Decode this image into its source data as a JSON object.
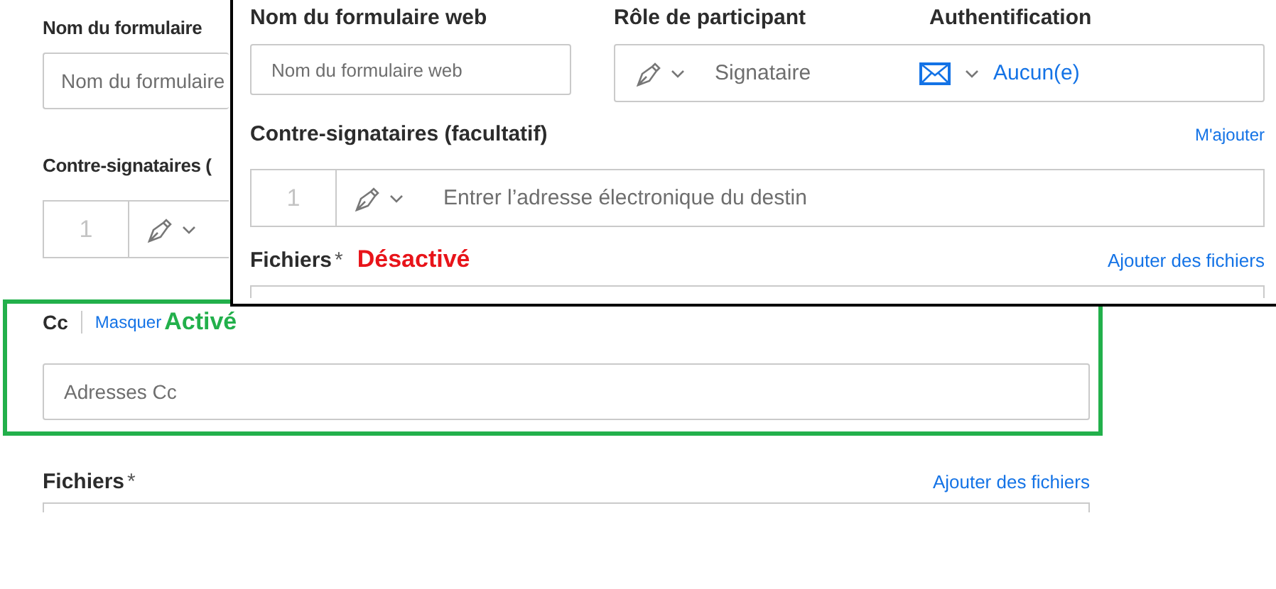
{
  "background_form": {
    "form_name": {
      "label": "Nom du formulaire",
      "placeholder": "Nom du formulaire"
    },
    "cosigners": {
      "label": "Contre-signataires (",
      "rows": [
        {
          "number": "1"
        }
      ]
    },
    "cc": {
      "label": "Cc",
      "hide_link": "Masquer",
      "annotation": {
        "text": "Activé",
        "kind": "enabled"
      },
      "placeholder": "Adresses Cc"
    },
    "files": {
      "label": "Fichiers",
      "required_mark": "*",
      "add_link": "Ajouter des fichiers"
    }
  },
  "overlay_form": {
    "form_name": {
      "label": "Nom du formulaire web",
      "placeholder": "Nom du formulaire web"
    },
    "participant_role": {
      "label": "Rôle de participant",
      "value": "Signataire"
    },
    "authentication": {
      "label": "Authentification",
      "value": "Aucun(e)"
    },
    "cosigners": {
      "label": "Contre-signataires (facultatif)",
      "add_me_link": "M'ajouter",
      "rows": [
        {
          "number": "1",
          "placeholder": "Entrer l’adresse électronique du destin"
        }
      ]
    },
    "files": {
      "label": "Fichiers",
      "required_mark": "*",
      "annotation": {
        "text": "Désactivé",
        "kind": "disabled"
      },
      "add_link": "Ajouter des fichiers"
    }
  }
}
